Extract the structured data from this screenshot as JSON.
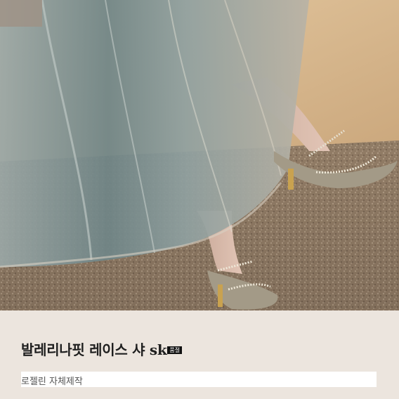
{
  "product": {
    "title": "발레리나핏 레이스 샤 sk",
    "badge": "품절",
    "subtitle": "로젤린 자체제작"
  },
  "image": {
    "description_icon": "product-photo",
    "colors": {
      "gravel": "#8a7661",
      "skirt": "#7f9294",
      "wall": "#d8b88e",
      "shoe": "#a39a87",
      "background": "#ece5de"
    }
  }
}
